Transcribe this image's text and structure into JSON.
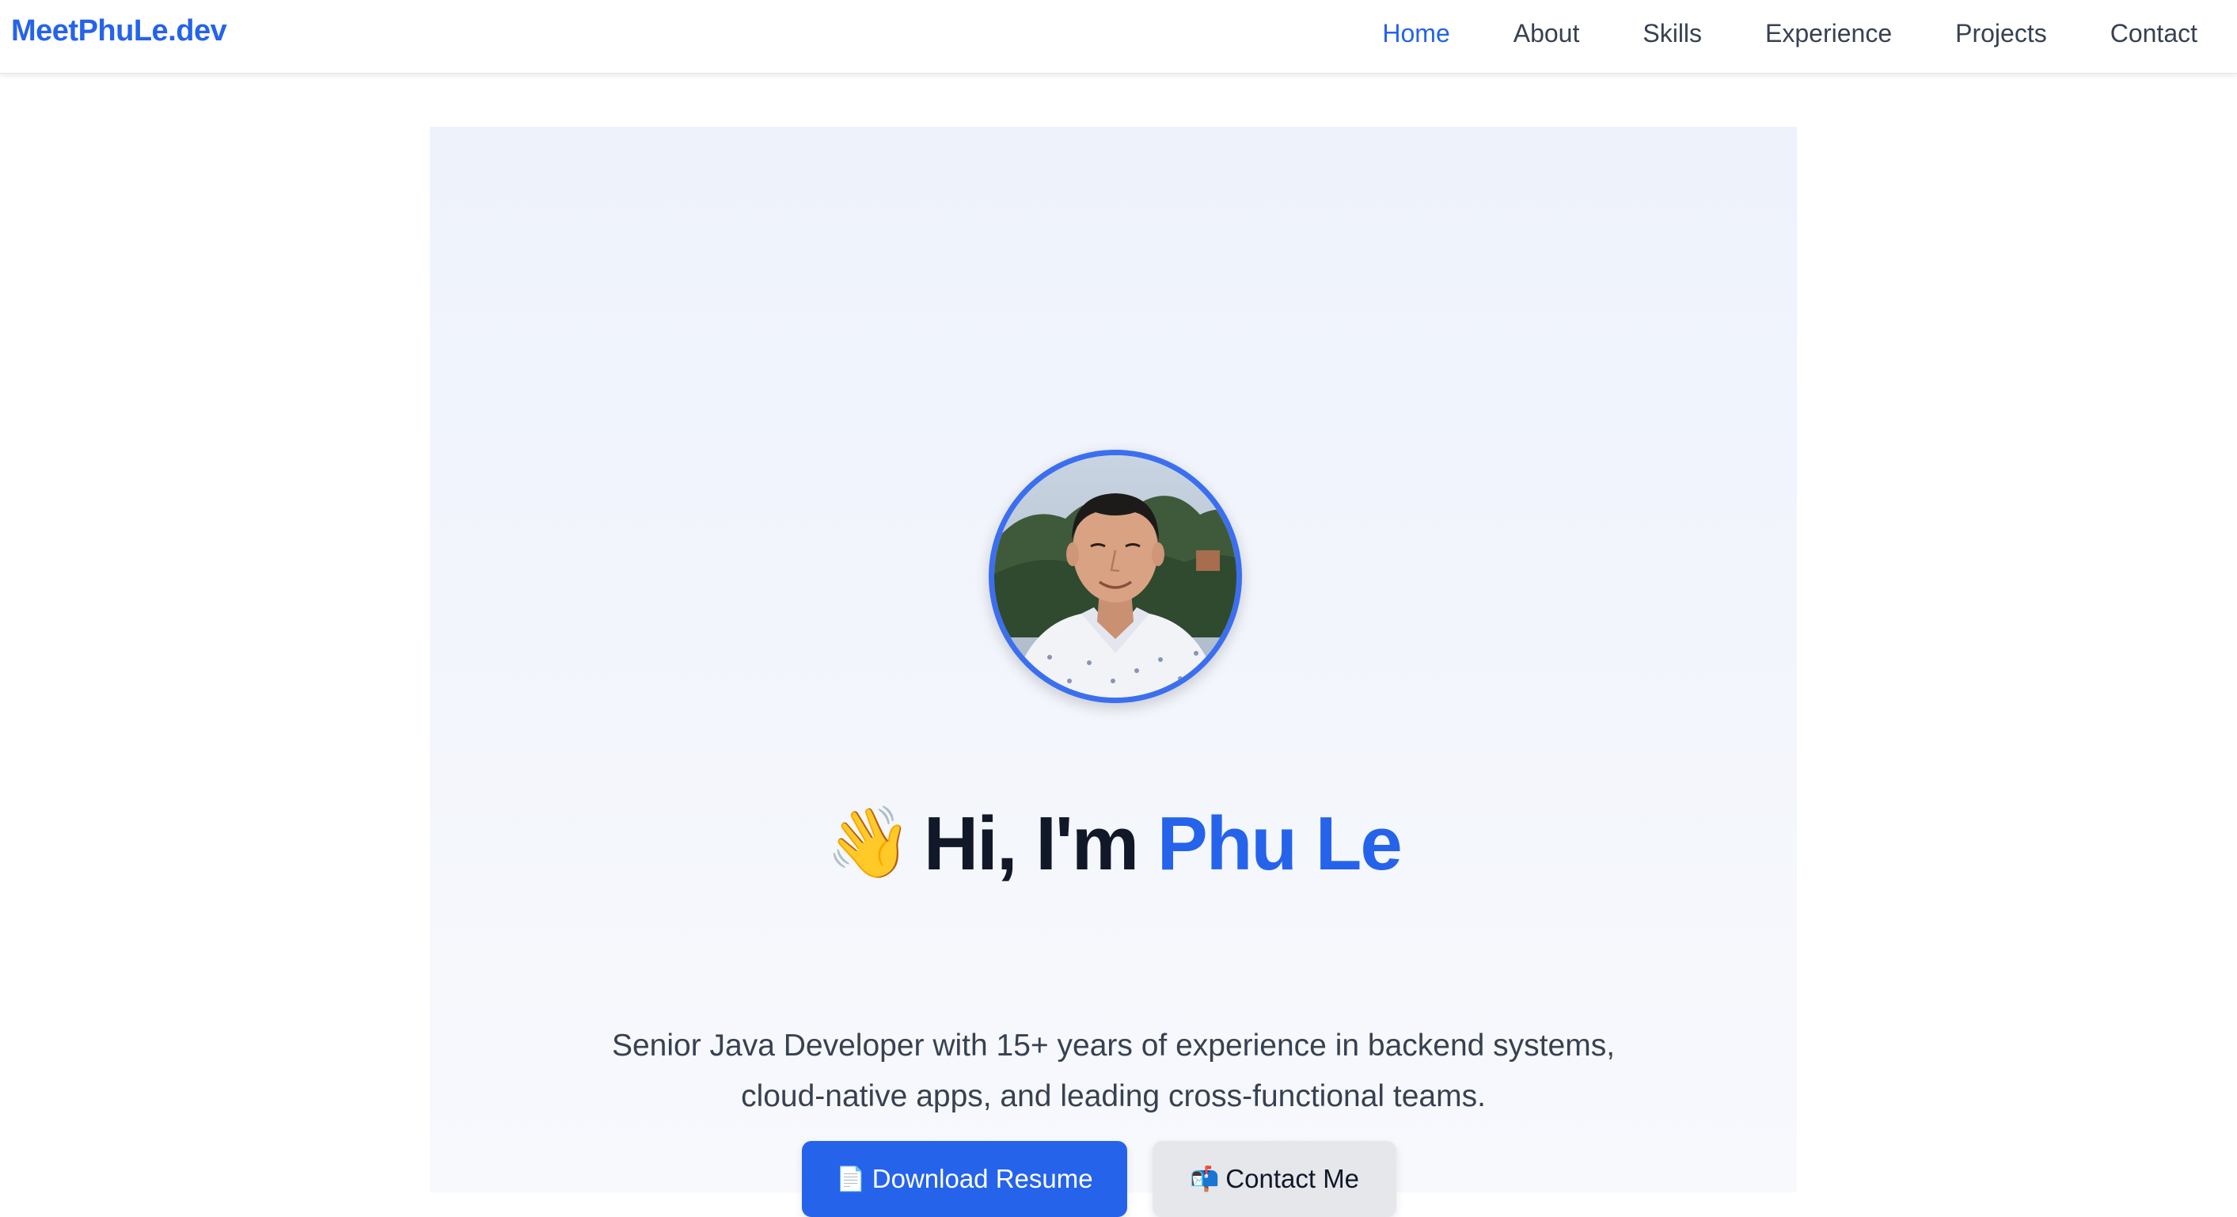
{
  "navbar": {
    "brand": "MeetPhuLe.dev",
    "links": [
      {
        "label": "Home",
        "active": true
      },
      {
        "label": "About",
        "active": false
      },
      {
        "label": "Skills",
        "active": false
      },
      {
        "label": "Experience",
        "active": false
      },
      {
        "label": "Projects",
        "active": false
      },
      {
        "label": "Contact",
        "active": false
      }
    ]
  },
  "hero": {
    "wave_emoji": "👋",
    "greeting_prefix": "Hi, I'm",
    "name": "Phu Le",
    "tagline_line1": "Senior Java Developer with 15+ years of experience in backend systems,",
    "tagline_line2": "cloud-native apps, and leading cross-functional teams.",
    "buttons": {
      "primary": {
        "icon": "📄",
        "label": "Download Resume"
      },
      "secondary": {
        "icon": "📬",
        "label": "Contact Me"
      }
    }
  },
  "colors": {
    "accent": "#2563eb",
    "heading": "#111827",
    "body_text": "#374151",
    "secondary_button": "#e5e7eb"
  }
}
